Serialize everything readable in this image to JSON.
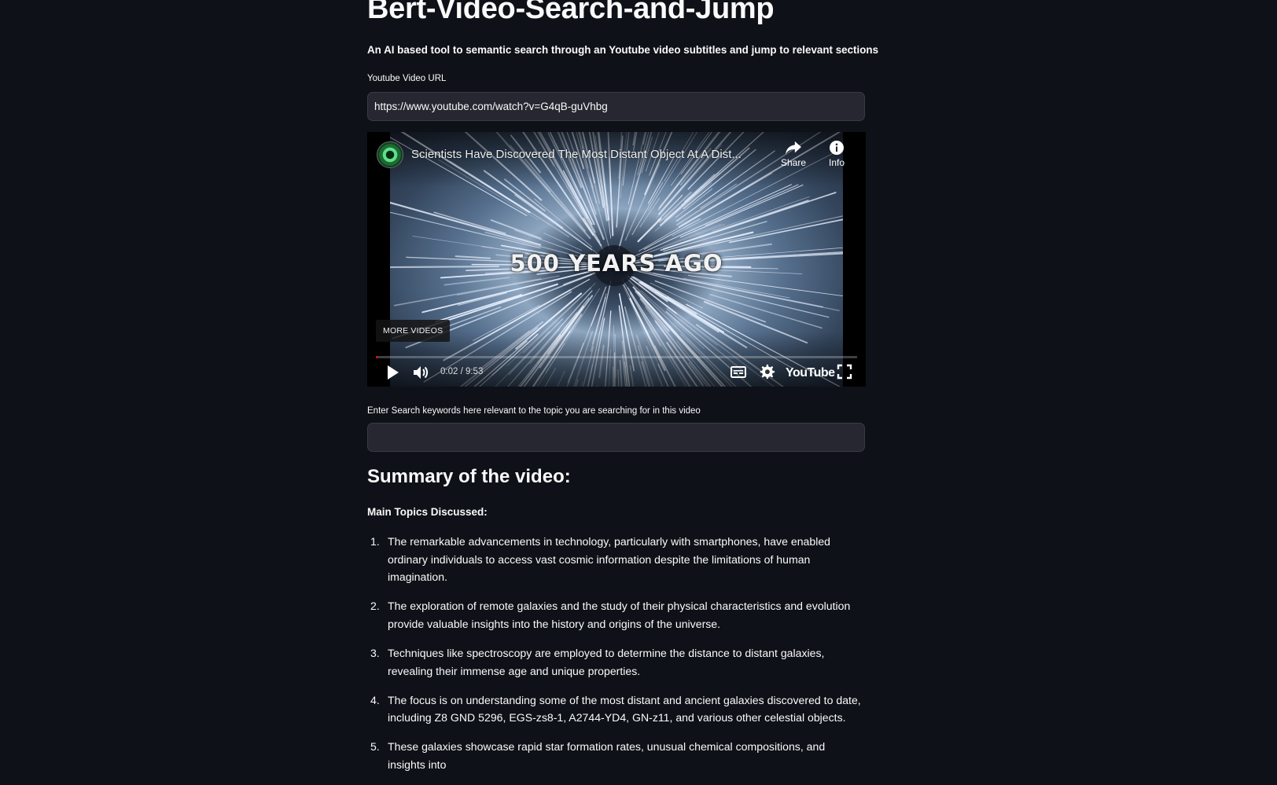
{
  "app": {
    "title": "Bert-Video-Search-and-Jump",
    "subtitle": "An AI based tool to semantic search through an Youtube video subtitles and jump to relevant sections"
  },
  "url_field": {
    "label": "Youtube Video URL",
    "value": "https://www.youtube.com/watch?v=G4qB-guVhbg"
  },
  "video": {
    "title": "Scientists Have Discovered The Most Distant Object At A Dist...",
    "share_label": "Share",
    "info_label": "Info",
    "frame_caption": "500 YEARS AGO",
    "more_videos_label": "MORE VIDEOS",
    "time_display": "0:02 / 9:53",
    "progress_fraction": 0.0034,
    "brand_label": "YouTube"
  },
  "search_field": {
    "label": "Enter Search keywords here relevant to the topic you are searching for in this video",
    "value": ""
  },
  "summary": {
    "heading": "Summary of the video:",
    "topics_heading": "Main Topics Discussed:",
    "topics": [
      {
        "num": "1.",
        "text": "The remarkable advancements in technology, particularly with smartphones, have enabled ordinary individuals to access vast cosmic information despite the limitations of human imagination."
      },
      {
        "num": "2.",
        "text": "The exploration of remote galaxies and the study of their physical characteristics and evolution provide valuable insights into the history and origins of the universe."
      },
      {
        "num": "3.",
        "text": "Techniques like spectroscopy are employed to determine the distance to distant galaxies, revealing their immense age and unique properties."
      },
      {
        "num": "4.",
        "text": "The focus is on understanding some of the most distant and ancient galaxies discovered to date, including Z8 GND 5296, EGS-zs8-1, A2744-YD4, GN-z11, and various other celestial objects."
      },
      {
        "num": "5.",
        "text": "These galaxies showcase rapid star formation rates, unusual chemical compositions, and insights into"
      }
    ]
  },
  "colors": {
    "background": "#0e1117",
    "input_background": "#262730",
    "text": "#fafafa",
    "progress": "#ff0000"
  }
}
